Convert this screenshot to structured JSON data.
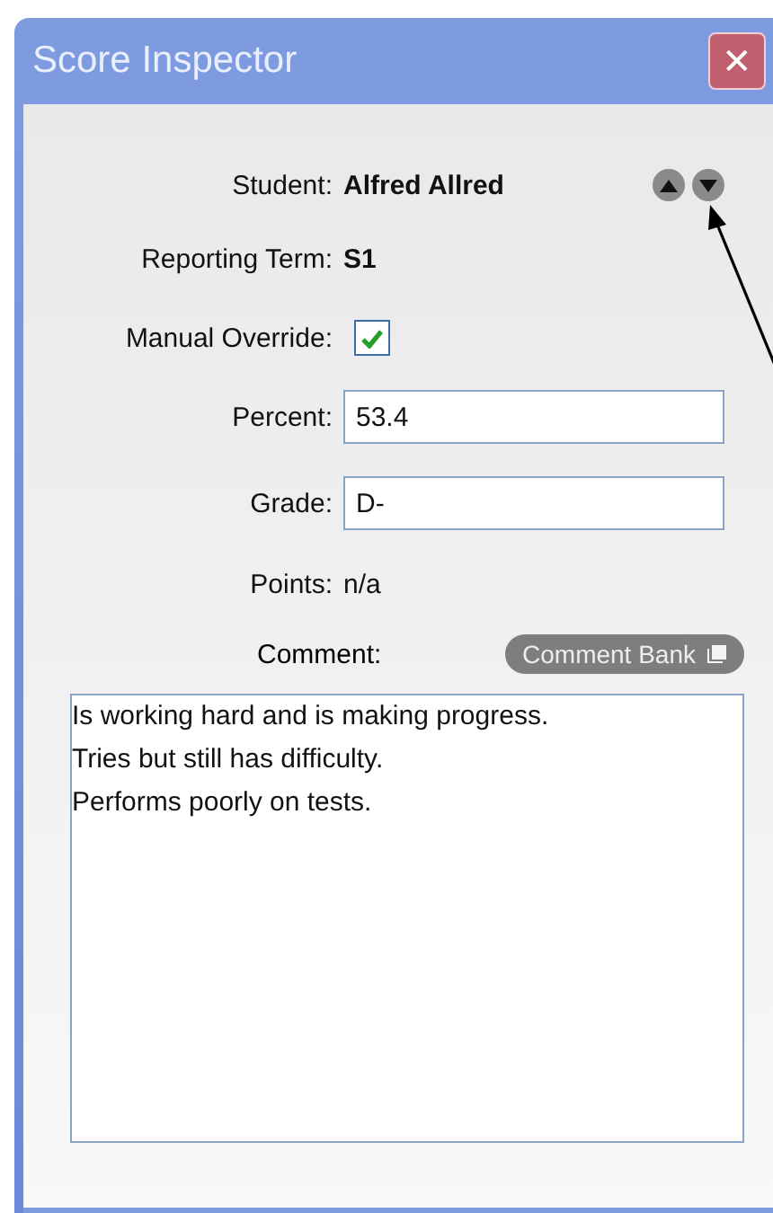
{
  "window": {
    "title": "Score Inspector",
    "close": "✕"
  },
  "student": {
    "label": "Student:",
    "value": "Alfred Allred"
  },
  "reporting_term": {
    "label": "Reporting Term:",
    "value": "S1"
  },
  "manual_override": {
    "label": "Manual Override:",
    "checked": true
  },
  "percent": {
    "label": "Percent:",
    "value": "53.4"
  },
  "grade": {
    "label": "Grade:",
    "value": "D-"
  },
  "points": {
    "label": "Points:",
    "value": "n/a"
  },
  "comment": {
    "label": "Comment:",
    "bank_button": "Comment Bank",
    "value": "Is working hard and is making progress.\nTries but still has difficulty.\nPerforms poorly on tests."
  }
}
